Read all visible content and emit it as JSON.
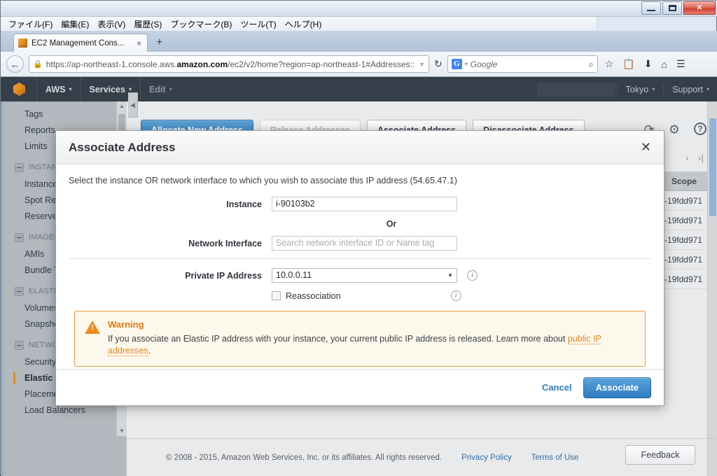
{
  "window": {
    "minimize_label": "minimize",
    "maximize_label": "maximize",
    "close_label": "✕"
  },
  "browser": {
    "menubar": [
      {
        "label": "ファイル(F)"
      },
      {
        "label": "編集(E)"
      },
      {
        "label": "表示(V)"
      },
      {
        "label": "履歴(S)"
      },
      {
        "label": "ブックマーク(B)"
      },
      {
        "label": "ツール(T)"
      },
      {
        "label": "ヘルプ(H)"
      }
    ],
    "tab": {
      "title": "EC2 Management Cons...",
      "close": "×"
    },
    "new_tab": "+",
    "back": "←",
    "url_prefix": "https://ap-northeast-1.console.aws.",
    "url_domain": "amazon.com",
    "url_suffix": "/ec2/v2/home?region=ap-northeast-1#Addresses::",
    "url_dropdown": "▼",
    "reload": "↻",
    "search": {
      "logo": "G",
      "caret": "▾",
      "term": "Google",
      "magnifier": "⌕"
    },
    "toolbar_icons": [
      "☆",
      "Ὄb",
      "⬇",
      "⌂",
      "☰"
    ]
  },
  "aws_nav": {
    "logo": "aws-cube",
    "items": [
      {
        "label": "AWS",
        "caret": "▾",
        "dim": false
      },
      {
        "label": "Services",
        "caret": "▾",
        "dim": false
      },
      {
        "label": "Edit",
        "caret": "▾",
        "dim": true
      }
    ],
    "region": {
      "label": "Tokyo",
      "caret": "▾"
    },
    "support": {
      "label": "Support",
      "caret": "▾"
    }
  },
  "sidebar": {
    "items": [
      {
        "type": "item",
        "label": "Tags"
      },
      {
        "type": "item",
        "label": "Reports"
      },
      {
        "type": "item",
        "label": "Limits"
      },
      {
        "type": "head",
        "label": "INSTANCES"
      },
      {
        "type": "item",
        "label": "Instances"
      },
      {
        "type": "item",
        "label": "Spot Requests"
      },
      {
        "type": "item",
        "label": "Reserved Instances"
      },
      {
        "type": "head",
        "label": "IMAGES"
      },
      {
        "type": "item",
        "label": "AMIs"
      },
      {
        "type": "item",
        "label": "Bundle Tasks"
      },
      {
        "type": "head",
        "label": "ELASTIC BLOCK STORE"
      },
      {
        "type": "item",
        "label": "Volumes"
      },
      {
        "type": "item",
        "label": "Snapshots"
      },
      {
        "type": "head",
        "label": "NETWORK & SECURITY"
      },
      {
        "type": "item",
        "label": "Security Groups"
      },
      {
        "type": "item",
        "label": "Elastic IPs",
        "selected": true
      },
      {
        "type": "item",
        "label": "Placement Groups"
      },
      {
        "type": "item",
        "label": "Load Balancers"
      }
    ]
  },
  "toolbar": {
    "allocate_label": "Allocate New Address",
    "release_label": "Release Addresses",
    "associate_label": "Associate Address",
    "disassociate_label": "Disassociate Address",
    "refresh_icon": "⟳",
    "gear_icon": "⚙",
    "help_icon": "?"
  },
  "pager": {
    "next": "›",
    "last": "›|"
  },
  "table": {
    "scope_header": "Scope",
    "rows": [
      {
        "scope": "-19fdd971"
      },
      {
        "scope": "-19fdd971"
      },
      {
        "scope": "-19fdd971"
      },
      {
        "scope": "-19fdd971"
      },
      {
        "scope": "-19fdd971"
      }
    ]
  },
  "modal": {
    "title": "Associate Address",
    "close_icon": "✕",
    "description": "Select the instance OR network interface to which you wish to associate this IP address (54.65.47.1)",
    "fields": {
      "instance_label": "Instance",
      "instance_value": "i-90103b2",
      "or_label": "Or",
      "network_interface_label": "Network Interface",
      "network_interface_placeholder": "Search network interface ID or Name tag",
      "private_ip_label": "Private IP Address",
      "private_ip_value": "10.0.0.11",
      "private_ip_caret": "▼",
      "reassociation_label": "Reassociation",
      "info_icon": "i"
    },
    "warning": {
      "title": "Warning",
      "text_before": "If you associate an Elastic IP address with your instance, your current public IP address is released. Learn more about ",
      "link": "public IP addresses",
      "text_after": "."
    },
    "cancel_label": "Cancel",
    "associate_label": "Associate"
  },
  "footer": {
    "copyright": "© 2008 - 2015, Amazon Web Services, Inc. or its affiliates. All rights reserved.",
    "privacy": "Privacy Policy",
    "terms": "Terms of Use",
    "feedback": "Feedback"
  },
  "colors": {
    "aws_orange": "#e8890c",
    "primary_blue": "#2f7cc0",
    "warning_orange": "#e07b12",
    "nav_dark": "#353f4a"
  }
}
